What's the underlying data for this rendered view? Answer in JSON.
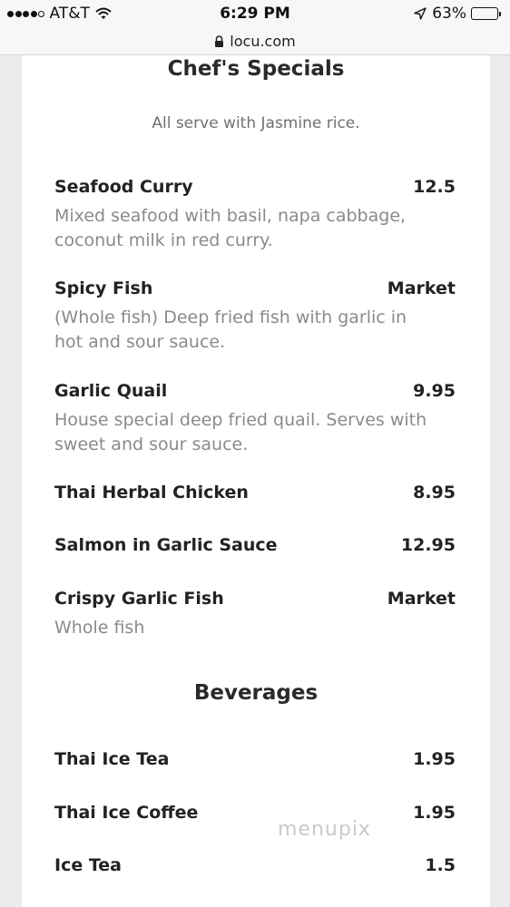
{
  "status_bar": {
    "carrier": "AT&T",
    "time": "6:29 PM",
    "battery": "63%",
    "battery_level": 0.63
  },
  "url_bar": {
    "url": "locu.com"
  },
  "chefs_specials": {
    "title": "Chef's Specials",
    "subtitle": "All serve with Jasmine rice.",
    "items": [
      {
        "name": "Seafood Curry",
        "price": "12.5",
        "desc": "Mixed seafood with basil, napa cabbage, coconut milk in red curry."
      },
      {
        "name": "Spicy Fish",
        "price": "Market",
        "desc": "(Whole fish) Deep fried fish with garlic in hot and sour sauce."
      },
      {
        "name": "Garlic Quail",
        "price": "9.95",
        "desc": "House special deep fried quail. Serves with sweet and sour sauce."
      },
      {
        "name": "Thai Herbal Chicken",
        "price": "8.95"
      },
      {
        "name": "Salmon in Garlic Sauce",
        "price": "12.95"
      },
      {
        "name": "Crispy Garlic Fish",
        "price": "Market",
        "desc": "Whole fish"
      }
    ]
  },
  "beverages": {
    "title": "Beverages",
    "items": [
      {
        "name": "Thai Ice Tea",
        "price": "1.95"
      },
      {
        "name": "Thai Ice Coffee",
        "price": "1.95"
      },
      {
        "name": "Ice Tea",
        "price": "1.5"
      }
    ]
  },
  "watermark": "menupix"
}
